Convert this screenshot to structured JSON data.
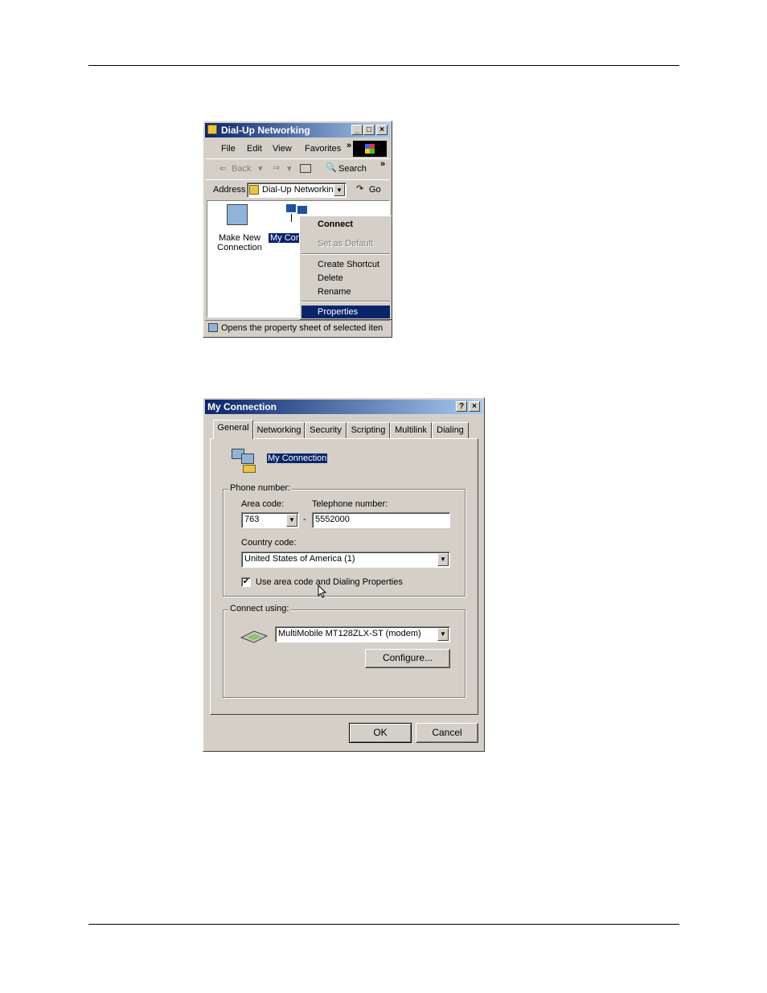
{
  "dun_window": {
    "title": "Dial-Up Networking",
    "menu": [
      "File",
      "Edit",
      "View",
      "Favorites"
    ],
    "menu_overflow": "»",
    "toolbar": {
      "back": "Back",
      "search": "Search",
      "overflow": "»"
    },
    "address": {
      "label": "Address",
      "value": "Dial-Up Networkin",
      "go": "Go"
    },
    "icons": [
      {
        "label_line1": "Make New",
        "label_line2": "Connection"
      },
      {
        "label": "My Conn"
      }
    ],
    "status": "Opens the property sheet of selected iten"
  },
  "context_menu": {
    "items": [
      "Connect",
      "Set as Default",
      "Create Shortcut",
      "Delete",
      "Rename",
      "Properties"
    ]
  },
  "connection_dialog": {
    "title": "My Connection",
    "help_glyph": "?",
    "close_glyph": "×",
    "tabs": [
      "General",
      "Networking",
      "Security",
      "Scripting",
      "Multilink",
      "Dialing"
    ],
    "connection_name": "My Connection",
    "phone_group": "Phone number:",
    "area_code_label": "Area code:",
    "area_code": "763",
    "dash": "-",
    "telephone_label": "Telephone number:",
    "telephone": "5552000",
    "country_label": "Country code:",
    "country": "United States of America (1)",
    "use_area_code": "Use area code and Dialing Properties",
    "use_area_code_checked": true,
    "connect_group": "Connect using:",
    "modem": "MultiMobile MT128ZLX-ST (modem)",
    "configure": "Configure...",
    "ok": "OK",
    "cancel": "Cancel"
  }
}
